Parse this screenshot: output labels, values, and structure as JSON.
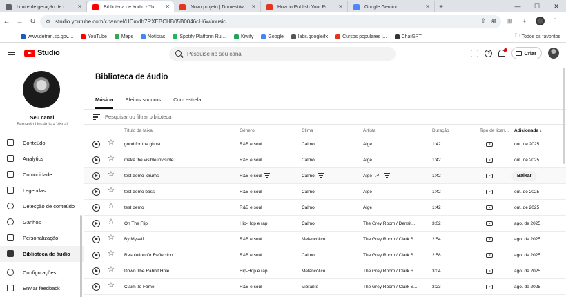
{
  "browser": {
    "tabs": [
      {
        "label": "Limite de geração de imagem",
        "favicon_color": "#5f6368"
      },
      {
        "label": "Biblioteca de áudio - YouTube",
        "favicon_color": "#ff0000",
        "active": true
      },
      {
        "label": "Novo projeto | Domestika",
        "favicon_color": "#e8331c"
      },
      {
        "label": "How to Publish Your Projects",
        "favicon_color": "#e8331c"
      },
      {
        "label": "Google Gemini",
        "favicon_color": "#4f86f7"
      }
    ],
    "url": "studio.youtube.com/channel/UCmdh7RXEBCHB05B0046cH6w/music",
    "bookmarks": [
      {
        "label": "www.detran.sp.gov....",
        "color": "#1a5cb8"
      },
      {
        "label": "YouTube",
        "color": "#ff0000"
      },
      {
        "label": "Maps",
        "color": "#34a853"
      },
      {
        "label": "Notícias",
        "color": "#4285f4"
      },
      {
        "label": "Spotify Platform Rul...",
        "color": "#1db954"
      },
      {
        "label": "Kiwify",
        "color": "#22a35a"
      },
      {
        "label": "Google",
        "color": "#4285f4"
      },
      {
        "label": "labs.google/fx",
        "color": "#555555"
      },
      {
        "label": "Cursos populares |...",
        "color": "#e8331c"
      },
      {
        "label": "ChatGPT",
        "color": "#333333"
      }
    ],
    "bookmarks_folder": "Todos os favoritos"
  },
  "studio": {
    "logo_text": "Studio",
    "search_placeholder": "Pesquise no seu canal",
    "create_label": "Criar"
  },
  "sidebar": {
    "channel_title": "Seu canal",
    "channel_name": "Bernardo Lins Artista Visual",
    "items": [
      {
        "label": "Conteúdo",
        "icon": "content-icon"
      },
      {
        "label": "Analytics",
        "icon": "analytics-icon"
      },
      {
        "label": "Comunidade",
        "icon": "community-icon"
      },
      {
        "label": "Legendas",
        "icon": "subtitles-icon"
      },
      {
        "label": "Detecção de conteúdo",
        "icon": "copyright-icon"
      },
      {
        "label": "Ganhos",
        "icon": "earn-icon"
      },
      {
        "label": "Personalização",
        "icon": "customization-icon"
      },
      {
        "label": "Biblioteca de áudio",
        "icon": "audio-library-icon",
        "active": true
      }
    ],
    "bottom_items": [
      {
        "label": "Configurações",
        "icon": "settings-icon"
      },
      {
        "label": "Enviar feedback",
        "icon": "feedback-icon"
      }
    ]
  },
  "main": {
    "title": "Biblioteca de áudio",
    "tabs": [
      {
        "label": "Música",
        "active": true
      },
      {
        "label": "Efeitos sonoros"
      },
      {
        "label": "Com estrela"
      }
    ],
    "filter_placeholder": "Pesquisar ou filtrar biblioteca",
    "columns": {
      "title": "Título da faixa",
      "genre": "Gênero",
      "mood": "Clima",
      "artist": "Artista",
      "duration": "Duração",
      "license": "Tipo de licen...",
      "added": "Adicionada"
    },
    "download_label": "Baixar",
    "tracks": [
      {
        "title": "good for the ghost",
        "genre": "R&B e soul",
        "mood": "Calmo",
        "artist": "Alge",
        "duration": "1:42",
        "added": "out. de 2025"
      },
      {
        "title": "make the visible invisible",
        "genre": "R&B e soul",
        "mood": "Calmo",
        "artist": "Alge",
        "duration": "1:42",
        "added": "out. de 2025"
      },
      {
        "title": "test demo_drums",
        "genre": "R&B e soul",
        "mood": "Calmo",
        "artist": "Alge",
        "duration": "1:42",
        "added": "",
        "hover": true
      },
      {
        "title": "test demo bass",
        "genre": "R&B e soul",
        "mood": "Calmo",
        "artist": "Alge",
        "duration": "1:42",
        "added": "out. de 2025"
      },
      {
        "title": "test demo",
        "genre": "R&B e soul",
        "mood": "Calmo",
        "artist": "Alge",
        "duration": "1:42",
        "added": "out. de 2025"
      },
      {
        "title": "On The Flip",
        "genre": "Hip-Hop e rap",
        "mood": "Calmo",
        "artist": "The Grey Room / Densit...",
        "duration": "3:02",
        "added": "ago. de 2025"
      },
      {
        "title": "By Myself",
        "genre": "R&B e soul",
        "mood": "Melancólico",
        "artist": "The Grey Room / Clark S...",
        "duration": "2:54",
        "added": "ago. de 2025"
      },
      {
        "title": "Resolution Or Reflection",
        "genre": "R&B e soul",
        "mood": "Calmo",
        "artist": "The Grey Room / Clark S...",
        "duration": "2:58",
        "added": "ago. de 2025"
      },
      {
        "title": "Down The Rabbit Hole",
        "genre": "Hip-Hop e rap",
        "mood": "Melancólico",
        "artist": "The Grey Room / Clark S...",
        "duration": "3:04",
        "added": "ago. de 2025"
      },
      {
        "title": "Claim To Fame",
        "genre": "R&B e soul",
        "mood": "Vibrante",
        "artist": "The Grey Room / Clark S...",
        "duration": "3:23",
        "added": "ago. de 2025"
      }
    ]
  }
}
